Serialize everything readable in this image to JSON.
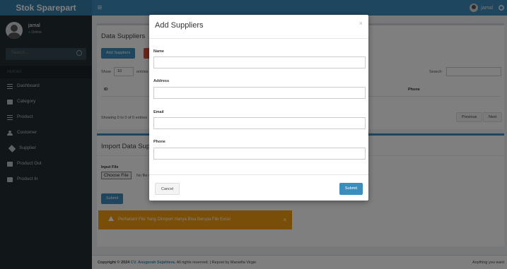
{
  "app": {
    "logo": "Stok Sparepart",
    "user": "jamal",
    "status": "Online"
  },
  "sidebar": {
    "search_placeholder": "Search...",
    "header": "HEADER",
    "items": [
      {
        "label": "Dashboard",
        "icon": "dashboard-icon"
      },
      {
        "label": "Category",
        "icon": "category-icon"
      },
      {
        "label": "Product",
        "icon": "product-icon"
      },
      {
        "label": "Customer",
        "icon": "customer-icon"
      },
      {
        "label": "Supplier",
        "icon": "supplier-icon"
      },
      {
        "label": "Product Out",
        "icon": "product-out-icon"
      },
      {
        "label": "Product In",
        "icon": "product-in-icon"
      }
    ]
  },
  "topbar": {
    "user": "jamal"
  },
  "suppliers_box": {
    "title": "Data Suppliers",
    "add_button": "Add Suppliers",
    "show_label": "Show",
    "show_value": "10",
    "entries_label": "entries",
    "search_label": "Search:",
    "columns": {
      "id": "ID",
      "phone": "Phone"
    },
    "info": "Showing 0 to 0 of 0 entries",
    "prev": "Previous",
    "next": "Next"
  },
  "import_box": {
    "title": "Import Data Suppliers",
    "file_label": "Input File",
    "choose_button": "Choose File",
    "no_file": "No file chosen",
    "submit": "Submit"
  },
  "alert": {
    "text": "Perhatian! File Yang Diimport Hanya Bisa Berupa File Excel"
  },
  "footer": {
    "prefix": "Copyright © 2024",
    "company": "CV. Anugerah Sejahtera.",
    "rest": "All rights reserved. | Repost by Marsella Virgie",
    "right": "Anything you want"
  },
  "modal": {
    "title": "Add Suppliers",
    "close": "×",
    "fields": [
      {
        "label": "Name"
      },
      {
        "label": "Address"
      },
      {
        "label": "Email"
      },
      {
        "label": "Phone"
      }
    ],
    "cancel": "Cancel",
    "submit": "Submit"
  }
}
